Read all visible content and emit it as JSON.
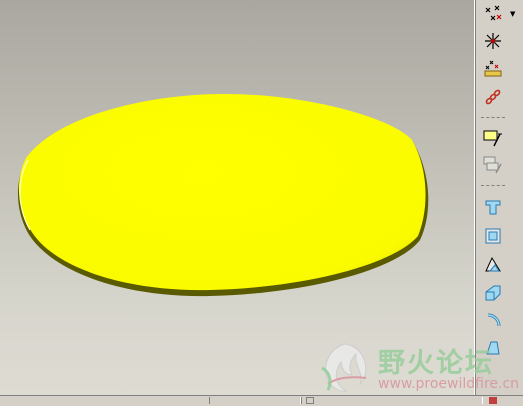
{
  "app": {
    "toolbar": {
      "items": [
        {
          "name": "datum-points-icon"
        },
        {
          "name": "sketched-datum-point-icon"
        },
        {
          "name": "offset-point-icon"
        },
        {
          "name": "datum-curve-icon"
        },
        {
          "name": "sketch-tool-icon"
        },
        {
          "name": "sketch-copy-icon"
        },
        {
          "name": "extrude-icon"
        },
        {
          "name": "hole-icon"
        },
        {
          "name": "rib-icon"
        },
        {
          "name": "round-icon"
        },
        {
          "name": "chamfer-icon"
        },
        {
          "name": "draft-icon"
        }
      ],
      "accent": "#44aadd"
    },
    "model": {
      "fill_color": "#ffff00",
      "edge_color": "#6e6e00"
    },
    "watermark": {
      "title": "野火论坛",
      "url": "www.proewildfire.cn"
    }
  }
}
